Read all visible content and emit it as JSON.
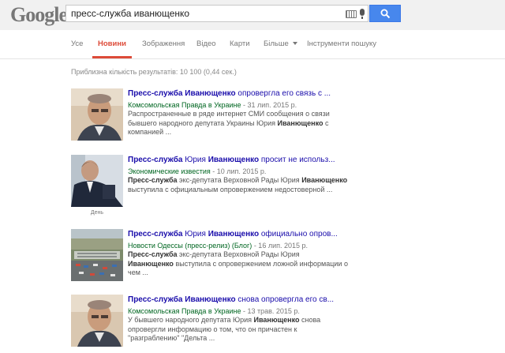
{
  "header": {
    "logo_text": "Google",
    "search_value": "пресс-служба иванющенко"
  },
  "tabs": [
    {
      "label": "Усе"
    },
    {
      "label": "Новини"
    },
    {
      "label": "Зображення"
    },
    {
      "label": "Відео"
    },
    {
      "label": "Карти"
    },
    {
      "label": "Більше"
    },
    {
      "label": "Інструменти пошуку"
    }
  ],
  "stats": "Приблизна кількість результатів: 10 100 (0,44 сек.)",
  "results": [
    {
      "title_a": "Пресс-служба Иванющенко",
      "title_b": " опровергла его связь с ...",
      "publisher": "Комсомольская Правда в Украине",
      "date": " - 31 лип. 2015 р.",
      "snippet_1": "Распространенные в ряде интернет СМИ сообщения о связи",
      "snippet_2a": "бывшего народного депутата Украины Юрия ",
      "snippet_2b": "Иванющенко",
      "snippet_2c": " с",
      "snippet_3": "компанией ..."
    },
    {
      "title_a": "Пресс-служба",
      "title_b": " Юрия ",
      "title_c": "Иванющенко",
      "title_d": " просит не использ...",
      "publisher": "Экономические известия",
      "date": " - 10 лип. 2015 р.",
      "snippet_1a": "Пресс-служба",
      "snippet_1b": " экс-депутата Верховной Рады Юрия ",
      "snippet_1c": "Иванющенко",
      "snippet_2": "выступила с официальным опровержением недостоверной ...",
      "thumb_caption": "День"
    },
    {
      "title_a": "Пресс-служба",
      "title_b": " Юрия ",
      "title_c": "Иванющенко",
      "title_d": " официально опров...",
      "publisher": "Новости Одессы (пресс-релиз) (Блог)",
      "date": " - 16 лип. 2015 р.",
      "snippet_1a": "Пресс-служба",
      "snippet_1b": " экс-депутата Верховной Рады Юрия",
      "snippet_2a": "Иванющенко",
      "snippet_2b": " выступила с опровержением ложной информации о",
      "snippet_3": "чем ..."
    },
    {
      "title_a": "Пресс-служба Иванющенко",
      "title_b": " снова опровергла его св...",
      "publisher": "Комсомольская Правда в Украине",
      "date": " - 13 трав. 2015 р.",
      "snippet_1a": "У бывшего народного депутата Юрия ",
      "snippet_1b": "Иванющенко",
      "snippet_1c": " снова",
      "snippet_2": "опровергли информацию о том, что он причастен к",
      "snippet_3": "\"разграблению\" \"Дельта ..."
    }
  ]
}
